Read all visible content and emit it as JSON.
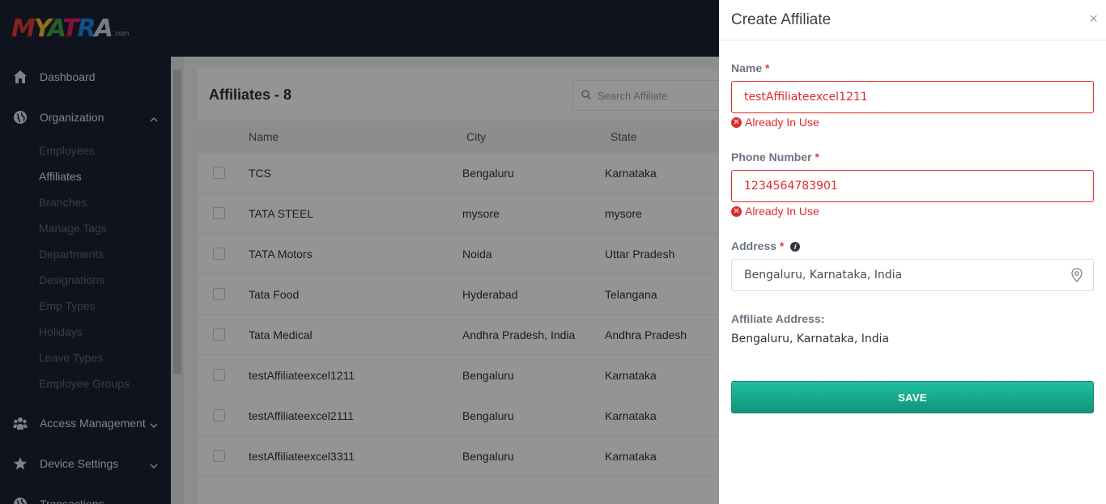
{
  "logo": {
    "text": "MYATRA",
    "suffix": ".com"
  },
  "sidebar": {
    "items": [
      {
        "label": "Dashboard",
        "icon": "home-icon"
      },
      {
        "label": "Organization",
        "icon": "globe-icon"
      },
      {
        "label": "Access Management",
        "icon": "users-icon"
      },
      {
        "label": "Device Settings",
        "icon": "star-icon"
      },
      {
        "label": "Transactions",
        "icon": "globe-icon"
      }
    ],
    "sub_items": [
      "Employees",
      "Affiliates",
      "Branches",
      "Manage Tags",
      "Departments",
      "Designations",
      "Emp Types",
      "Holidays",
      "Leave Types",
      "Employee Groups"
    ]
  },
  "main": {
    "title": "Affiliates - 8",
    "search_placeholder": "Search Affiliate",
    "columns": [
      "Name",
      "City",
      "State"
    ],
    "rows": [
      {
        "name": "TCS",
        "city": "Bengaluru",
        "state": "Karnataka"
      },
      {
        "name": "TATA STEEL",
        "city": "mysore",
        "state": "mysore"
      },
      {
        "name": "TATA Motors",
        "city": "Noida",
        "state": "Uttar Pradesh"
      },
      {
        "name": "Tata Food",
        "city": "Hyderabad",
        "state": "Telangana"
      },
      {
        "name": "Tata Medical",
        "city": "Andhra Pradesh, India",
        "state": "Andhra Pradesh"
      },
      {
        "name": "testAffiliateexcel1211",
        "city": "Bengaluru",
        "state": "Karnataka"
      },
      {
        "name": "testAffiliateexcel2111",
        "city": "Bengaluru",
        "state": "Karnataka"
      },
      {
        "name": "testAffiliateexcel3311",
        "city": "Bengaluru",
        "state": "Karnataka"
      }
    ]
  },
  "drawer": {
    "title": "Create Affiliate",
    "close": "×",
    "name_label": "Name",
    "name_value": "testAffiliateexcel1211",
    "name_error": "Already In Use",
    "phone_label": "Phone Number",
    "phone_value": "1234564783901",
    "phone_error": "Already In Use",
    "address_label": "Address",
    "address_value": "Bengaluru, Karnataka, India",
    "affiliate_address_label": "Affiliate Address:",
    "affiliate_address_value": "Bengaluru, Karnataka, India",
    "save_label": "SAVE",
    "required_mark": "*"
  },
  "colors": {
    "accent": "#1aa98c",
    "error": "#e0292e",
    "sidebar": "#1a2233"
  }
}
